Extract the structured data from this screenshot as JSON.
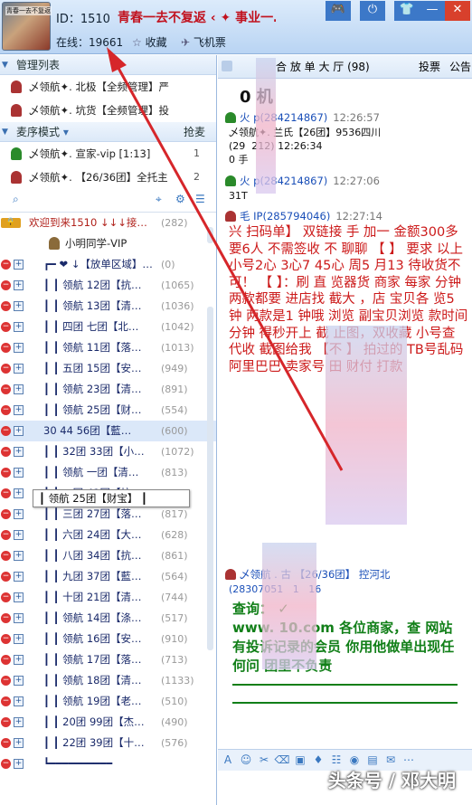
{
  "header": {
    "avatar_text": "青春一去不复返",
    "id_label": "ID：1510",
    "room_name": "青春一去不复返 ‹ ✦ 事业一…",
    "online": "在线：19661",
    "favorite": "收藏",
    "tickets": "飞机票"
  },
  "left": {
    "admin_section": "管理列表",
    "admins": [
      {
        "name": "乄领航✦. 北极【全频管理】严",
        "count": ""
      },
      {
        "name": "乄领航✦. 坑货【全频管理】投",
        "count": ""
      }
    ],
    "mic_section": "麦序模式",
    "grab_mic": "抢麦",
    "mic_users": [
      {
        "name": "乄领航✦.    宣家-vip   [1:13]",
        "count": "1"
      },
      {
        "name": "乄领航✦.    【26/36团】全托主",
        "count": "2"
      }
    ],
    "welcome": "欢迎到来1510 ↓↓↓接…",
    "welcome_count": "(282)",
    "user_vip": "小明同学-VIP",
    "tree": [
      {
        "label": "┏━ ❤ ↓【放单区域】…",
        "count": "(0)"
      },
      {
        "label": "┃ ┃ 领航 12团【抗…",
        "count": "(1065)"
      },
      {
        "label": "┃ ┃ 领航 13团【清…",
        "count": "(1036)"
      },
      {
        "label": "┃ ┃ 四团 七团【北…",
        "count": "(1042)"
      },
      {
        "label": "┃ ┃ 领航 11团【落…",
        "count": "(1013)"
      },
      {
        "label": "┃ ┃ 五团 15团【安…",
        "count": "(949)"
      },
      {
        "label": "┃ ┃ 领航 23团【清…",
        "count": "(891)"
      },
      {
        "label": "┃ ┃ 领航 25团【财…",
        "count": "(554)"
      },
      {
        "label": "  30 44  56团【藍…",
        "count": "(600)"
      },
      {
        "label": "┃ ┃ 32团 33团【小…",
        "count": "(1072)"
      },
      {
        "label": "┃ ┃ 领航 一团【清…",
        "count": "(813)"
      },
      {
        "label": "┃ ┃ 二团 41团【抗…",
        "count": "(843)"
      },
      {
        "label": "┃ ┃ 三团 27团【落…",
        "count": "(817)"
      },
      {
        "label": "┃ ┃ 六团 24团【大…",
        "count": "(628)"
      },
      {
        "label": "┃ ┃ 八团 34团【抗…",
        "count": "(861)"
      },
      {
        "label": "┃ ┃ 九团 37团【藍…",
        "count": "(564)"
      },
      {
        "label": "┃ ┃ 十团 21团【清…",
        "count": "(744)"
      },
      {
        "label": "┃ ┃ 领航 14团【涤…",
        "count": "(517)"
      },
      {
        "label": "┃ ┃ 领航 16团【安…",
        "count": "(910)"
      },
      {
        "label": "┃ ┃ 领航 17团【落…",
        "count": "(713)"
      },
      {
        "label": "┃ ┃ 领航 18团【清…",
        "count": "(1133)"
      },
      {
        "label": "┃ ┃ 领航 19团【老…",
        "count": "(510)"
      },
      {
        "label": "┃ ┃ 20团 99团【杰…",
        "count": "(490)"
      },
      {
        "label": "┃ ┃ 22团 39团【十…",
        "count": "(576)"
      },
      {
        "label": "┗━━━━━━━━━━",
        "count": ""
      }
    ],
    "tooltip": "┃ 领航 25团【财宝】 ┃"
  },
  "right": {
    "tab_title": "合 放 单 大 厅 (98)",
    "tab_vote": "投票",
    "tab_notice": "公告",
    "big_title": "0      机",
    "messages": [
      {
        "name": "火   p(284214867)",
        "time": "12:26:57",
        "body": "乄领航✦. 兰氏【26团】9536四川\n(29  212) 12:26:34\n0 手"
      },
      {
        "name": "火   p(284214867)",
        "time": "12:27:06",
        "body": "31T"
      },
      {
        "name": "毛   IP(285794046)",
        "time": "12:27:14",
        "body": ""
      }
    ],
    "red_text": "兴  扫码单】    双链接   手   加一      金额300多   要6人     不需签收   不   聊聊   【   】    要求    以上小号2心  3心7 45心         周5  月13     待收货不可！   【   】：刷   直    览器货   商家 每家   分钟    两款都要    进店找   截大      ，店   宝贝各  览5  钟 两款是1      钟哦    浏览    副宝贝浏览   款时间      分钟    得秒开上      截    止图，双收藏       小号查    代收    截图给我    【不  】    拍过的     TB号乱码     阿里巴巴    卖家号    田      财付    打款",
    "last_msg_name": "乄领航  . 古   【26/36团】 控河北",
    "last_msg_sub": "(28307051   1   16",
    "green_query": "查询：    ✓",
    "green_body": "www.    10.com 各位商家，查   网站有投诉记录的会员   你用他做单出现任何问    团里不负责",
    "watermark": "头条号 / 邓大明"
  },
  "colors": {
    "accent": "#1a4fb8",
    "red": "#cc1a1a",
    "green": "#117f18",
    "room": "#c1121f"
  }
}
